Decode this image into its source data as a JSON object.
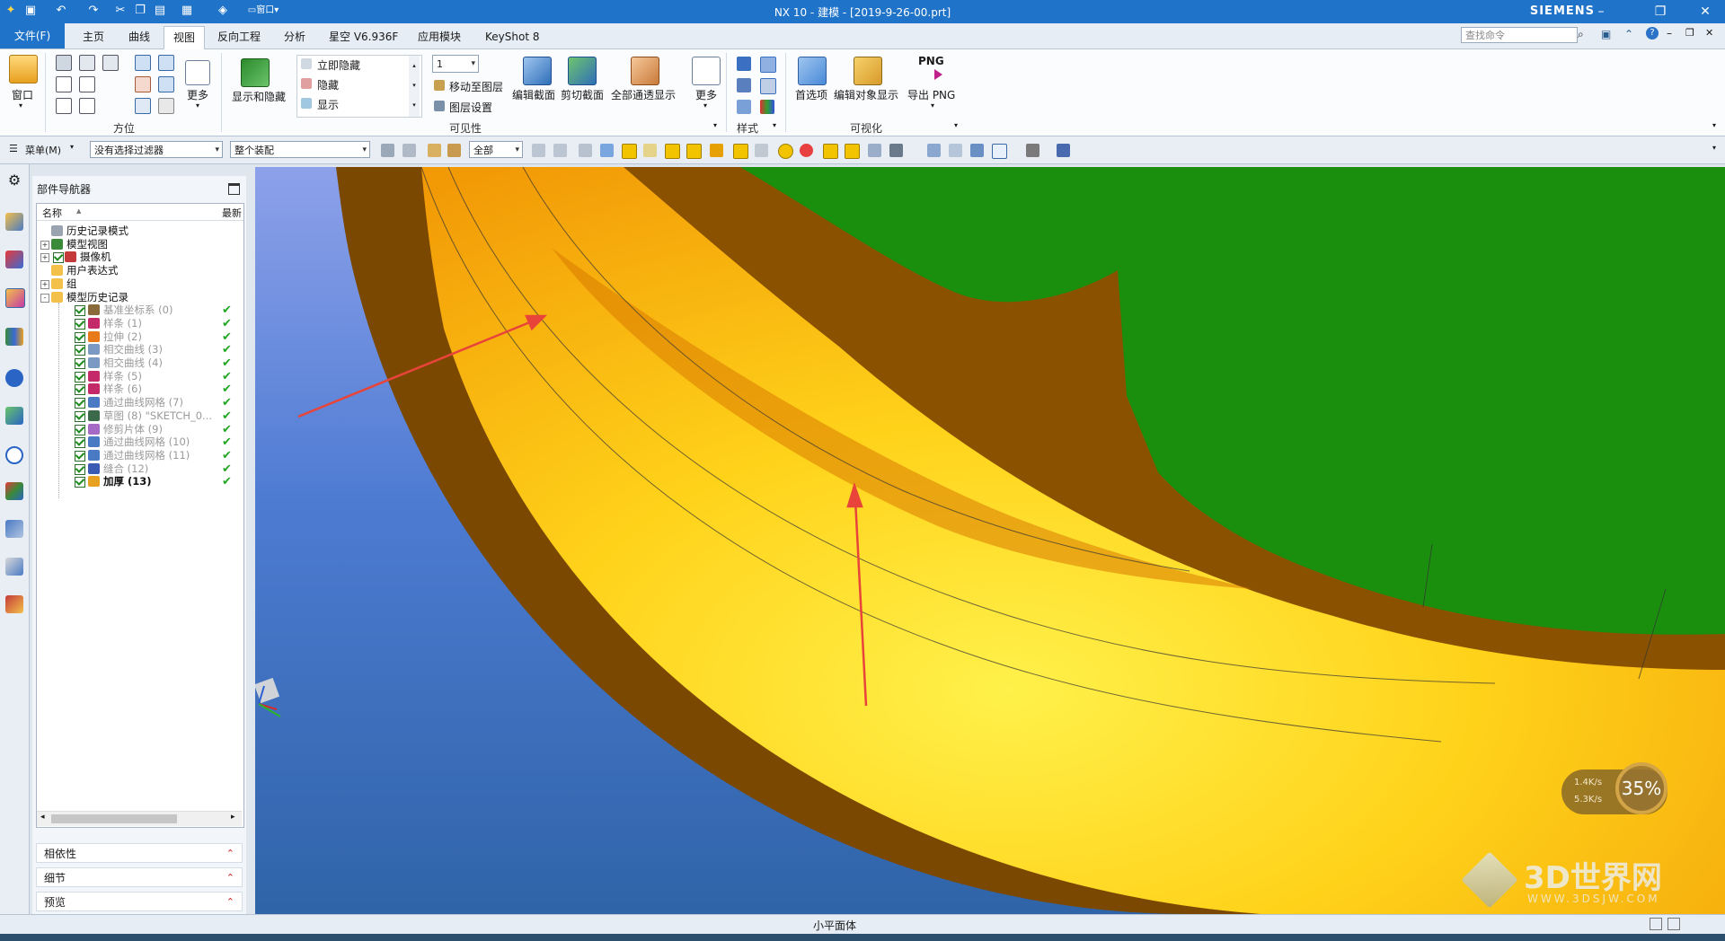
{
  "window": {
    "title": "NX 10 - 建模 - [2019-9-26-00.prt]",
    "brand": "SIEMENS",
    "accent": "#1f73c8"
  },
  "tabs": [
    "文件(F)",
    "主页",
    "曲线",
    "视图",
    "反向工程",
    "分析",
    "星空 V6.936F",
    "应用模块",
    "KeyShot 8"
  ],
  "active_tab": "视图",
  "search_placeholder": "查找命令",
  "ribbon": {
    "window_label": "窗口",
    "orientation_group": "方位",
    "more1": "更多",
    "show_hide": "显示和隐藏",
    "immediate_hide": "立即隐藏",
    "hide": "隐藏",
    "show": "显示",
    "layer_value": "1",
    "move_to_layer": "移动至图层",
    "layer_settings": "图层设置",
    "edit_section": "编辑截面",
    "clip_section": "剪切截面",
    "show_all": "全部通透显示",
    "more2": "更多",
    "visibility_group": "可见性",
    "style_group": "样式",
    "preferences": "首选项",
    "edit_object_display": "编辑对象显示",
    "png_badge": "PNG",
    "export_png": "导出 PNG",
    "visualization_group": "可视化"
  },
  "toolbar": {
    "menu_label": "菜单(M)",
    "filter_value": "没有选择过滤器",
    "scope_value": "整个装配",
    "all_value": "全部"
  },
  "navigator": {
    "title": "部件导航器",
    "col_name": "名称",
    "col_latest": "最新",
    "items": [
      {
        "label": "历史记录模式",
        "level": 0,
        "icon": "clock-icon",
        "check": false,
        "tick": false,
        "gray": false
      },
      {
        "label": "模型视图",
        "level": 0,
        "icon": "model-view-icon",
        "check": false,
        "tick": false,
        "gray": false,
        "expander": "+"
      },
      {
        "label": "摄像机",
        "level": 0,
        "icon": "camera-icon",
        "check": true,
        "tick": false,
        "gray": false,
        "expander": "+"
      },
      {
        "label": "用户表达式",
        "level": 0,
        "icon": "folder-icon",
        "check": false,
        "tick": false,
        "gray": false
      },
      {
        "label": "组",
        "level": 0,
        "icon": "folder-icon",
        "check": false,
        "tick": false,
        "gray": false,
        "expander": "+"
      },
      {
        "label": "模型历史记录",
        "level": 0,
        "icon": "folder-icon",
        "check": false,
        "tick": false,
        "gray": false,
        "expander": "-"
      },
      {
        "label": "基准坐标系 (0)",
        "level": 1,
        "icon": "datum-csys-icon",
        "check": true,
        "tick": true,
        "gray": true
      },
      {
        "label": "样条 (1)",
        "level": 1,
        "icon": "spline-icon",
        "check": true,
        "tick": true,
        "gray": true
      },
      {
        "label": "拉伸 (2)",
        "level": 1,
        "icon": "extrude-icon",
        "check": true,
        "tick": true,
        "gray": true
      },
      {
        "label": "相交曲线 (3)",
        "level": 1,
        "icon": "intersect-curve-icon",
        "check": true,
        "tick": true,
        "gray": true
      },
      {
        "label": "相交曲线 (4)",
        "level": 1,
        "icon": "intersect-curve-icon",
        "check": true,
        "tick": true,
        "gray": true
      },
      {
        "label": "样条 (5)",
        "level": 1,
        "icon": "spline-icon",
        "check": true,
        "tick": true,
        "gray": true
      },
      {
        "label": "样条 (6)",
        "level": 1,
        "icon": "spline-icon",
        "check": true,
        "tick": true,
        "gray": true
      },
      {
        "label": "通过曲线网格 (7)",
        "level": 1,
        "icon": "mesh-surface-icon",
        "check": true,
        "tick": true,
        "gray": true
      },
      {
        "label": "草图 (8) \"SKETCH_0...",
        "level": 1,
        "icon": "sketch-icon",
        "check": true,
        "tick": true,
        "gray": true
      },
      {
        "label": "修剪片体 (9)",
        "level": 1,
        "icon": "trim-sheet-icon",
        "check": true,
        "tick": true,
        "gray": true
      },
      {
        "label": "通过曲线网格 (10)",
        "level": 1,
        "icon": "mesh-surface-icon",
        "check": true,
        "tick": true,
        "gray": true
      },
      {
        "label": "通过曲线网格 (11)",
        "level": 1,
        "icon": "mesh-surface-icon",
        "check": true,
        "tick": true,
        "gray": true
      },
      {
        "label": "缝合 (12)",
        "level": 1,
        "icon": "sew-icon",
        "check": true,
        "tick": true,
        "gray": true
      },
      {
        "label": "加厚 (13)",
        "level": 1,
        "icon": "thicken-icon",
        "check": true,
        "tick": true,
        "gray": false,
        "bold": true
      }
    ],
    "panels": [
      "相依性",
      "细节",
      "预览"
    ]
  },
  "status_message": "小平面体",
  "speed_widget": {
    "up": "1.4K/s",
    "down": "5.3K/s",
    "percent": "35%"
  },
  "watermark": {
    "title": "3D世界网",
    "url": "WWW.3DSJW.COM"
  }
}
